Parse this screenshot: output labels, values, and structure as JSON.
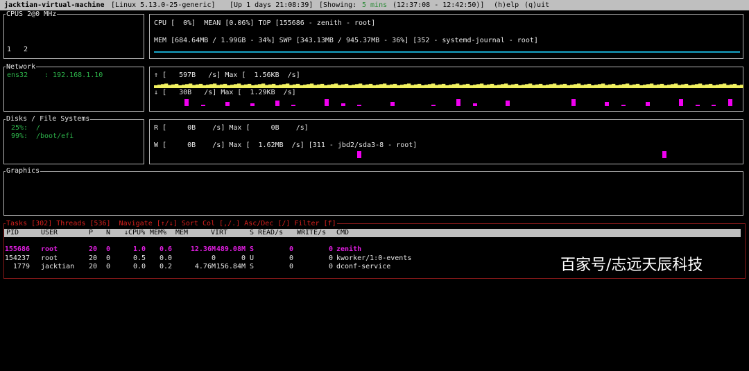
{
  "title_bar": {
    "hostname": "jacktian-virtual-machine",
    "kernel": "[Linux 5.13.0-25-generic]",
    "uptime": "[Up 1 days 21:08:39]",
    "showing_prefix": "[Showing:",
    "showing_value": "5 mins",
    "time_range": "(12:37:08 - 12:42:50)]",
    "help": "(h)elp",
    "quit": "(q)uit"
  },
  "cpus": {
    "title": "CPUS 2@0 MHz",
    "cores": [
      "1",
      "2"
    ],
    "cpu_line": "CPU [  0%]  MEAN [0.06%] TOP [155686 - zenith - root]",
    "mem_line": "MEM [684.64MB / 1.99GB - 34%] SWP [343.13MB / 945.37MB - 36%] [352 - systemd-journal - root]"
  },
  "network": {
    "title": "Network",
    "interface": "ens32",
    "address": ": 192.168.1.10",
    "upload_line": "↑ [   597B   /s] Max [  1.56KB  /s]",
    "download_line": "↓ [   30B   /s] Max [  1.29KB  /s]",
    "tx_level": 0.6,
    "rx_levels": [
      0,
      10,
      0,
      2,
      0,
      0,
      6,
      0,
      0,
      4,
      0,
      0,
      8,
      0,
      2,
      0,
      0,
      0,
      10,
      0,
      4,
      0,
      2,
      0,
      0,
      0,
      6,
      0,
      0,
      0,
      0,
      2,
      0,
      0,
      10,
      0,
      4,
      0,
      0,
      0,
      8,
      0,
      0,
      0,
      0,
      0,
      0,
      0,
      10,
      0,
      0,
      0,
      6,
      0,
      2,
      0,
      0,
      6,
      0,
      0,
      0,
      10,
      0,
      2,
      0,
      2,
      0,
      10
    ]
  },
  "disks": {
    "title": "Disks / File Systems",
    "filesystems": [
      {
        "usage": "25%:",
        "mount": "/"
      },
      {
        "usage": "99%:",
        "mount": "/boot/efi"
      }
    ],
    "read_line": "R [     0B    /s] Max [     0B    /s]",
    "write_line": "W [     0B    /s] Max [  1.62MB  /s] [311 - jbd2/sda3-8 - root]",
    "write_levels": [
      0,
      0,
      0,
      0,
      0,
      0,
      0,
      0,
      0,
      0,
      0,
      0,
      0,
      0,
      0,
      0,
      0,
      0,
      0,
      0,
      0,
      0,
      10,
      0,
      0,
      0,
      0,
      0,
      0,
      0,
      0,
      0,
      0,
      0,
      0,
      0,
      0,
      0,
      0,
      0,
      0,
      0,
      0,
      0,
      0,
      0,
      0,
      0,
      0,
      0,
      0,
      0,
      0,
      0,
      0,
      0,
      0,
      0,
      0,
      10,
      0,
      0,
      0,
      0,
      0,
      0,
      0,
      0
    ]
  },
  "graphics": {
    "title": "Graphics"
  },
  "processes": {
    "title": "Tasks [302] Threads [536]  Navigate [↑/↓] Sort Col [,/.] Asc/Dec [/] Filter [f]",
    "columns": [
      "PID",
      "USER",
      "P",
      "N",
      "↓CPU%",
      "MEM%",
      "MEM",
      "VIRT",
      "S",
      "READ/s",
      "WRITE/s",
      "CMD"
    ],
    "rows": [
      [
        "155686",
        "root",
        "20",
        "0",
        "1.0",
        "0.6",
        "12.36M",
        "489.08M",
        "S",
        "0",
        "0",
        "zenith"
      ],
      [
        "154237",
        "root",
        "20",
        "0",
        "0.5",
        "0.0",
        "0",
        "0",
        "U",
        "0",
        "0",
        "kworker/1:0-events"
      ],
      [
        "1779",
        "jacktian",
        "20",
        "0",
        "0.0",
        "0.2",
        "4.76M",
        "156.84M",
        "S",
        "0",
        "0",
        "dconf-service"
      ]
    ]
  },
  "watermark": "百家号/志远天辰科技",
  "colors": {
    "tx_bar": "#f0f060",
    "rx_spark": "#f000f0",
    "mem_bar": "#17a5c8",
    "accent_green": "#2db34a",
    "accent_red": "#d8201d",
    "selected_row": "#e11ee1"
  }
}
